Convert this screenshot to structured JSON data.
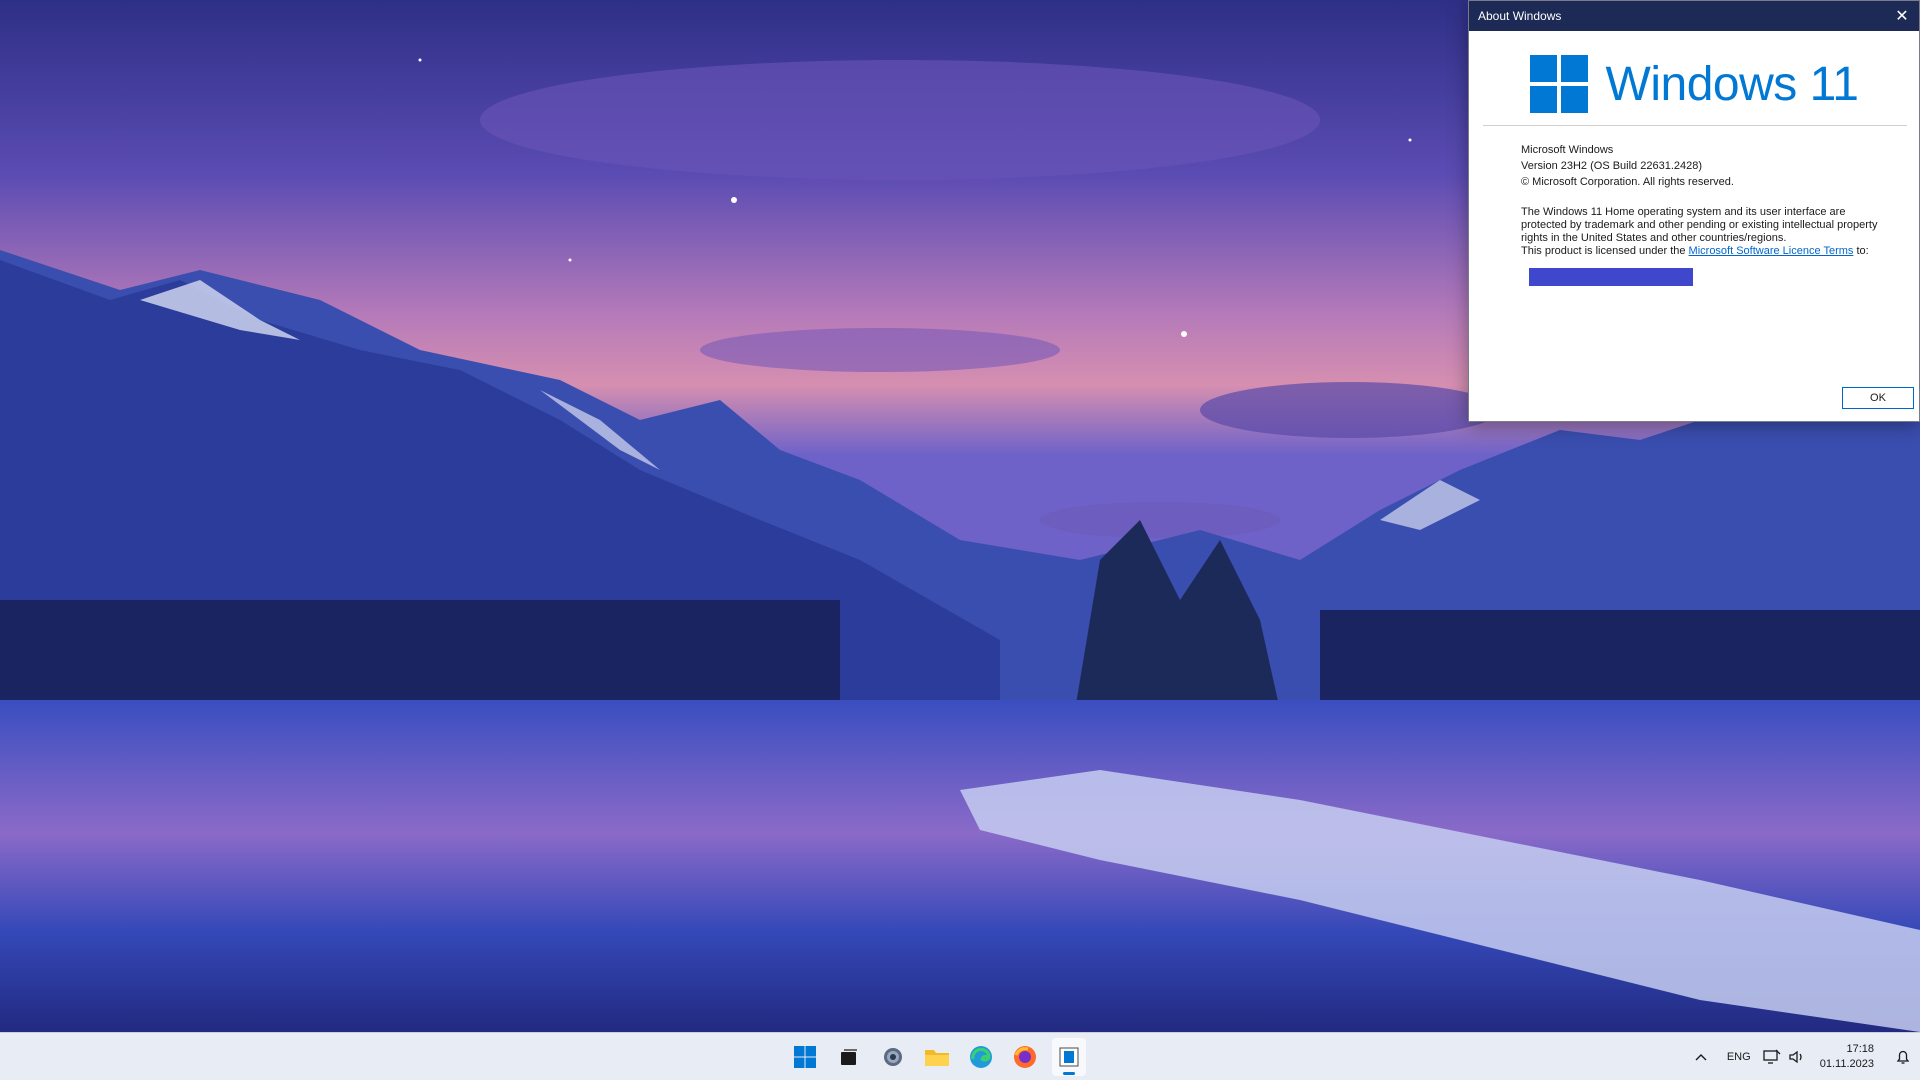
{
  "dialog": {
    "title": "About Windows",
    "close_glyph": "✕",
    "logo_text": "Windows 11",
    "product_name": "Microsoft Windows",
    "version": "Version 23H2 (OS Build 22631.2428)",
    "copyright": "© Microsoft Corporation. All rights reserved.",
    "legal_text": "The Windows 11 Home operating system and its user interface are protected by trademark and other pending or existing intellectual property rights in the United States and other countries/regions.",
    "license_prefix": "This product is licensed under the ",
    "license_link": "Microsoft Software Licence Terms",
    "license_suffix": " to:",
    "ok_label": "OK"
  },
  "taskbar": {
    "apps": [
      {
        "name": "start-icon"
      },
      {
        "name": "task-view-icon"
      },
      {
        "name": "settings-icon"
      },
      {
        "name": "file-explorer-icon"
      },
      {
        "name": "edge-icon"
      },
      {
        "name": "firefox-icon"
      },
      {
        "name": "winver-app-icon",
        "active": true
      }
    ],
    "tray": {
      "overflow_glyph": "^",
      "language": "ENG",
      "time": "17:18",
      "date": "01.11.2023"
    }
  },
  "colors": {
    "accent": "#0078d4",
    "titlebar": "#1c2a55",
    "redacted": "#3f48cc"
  }
}
